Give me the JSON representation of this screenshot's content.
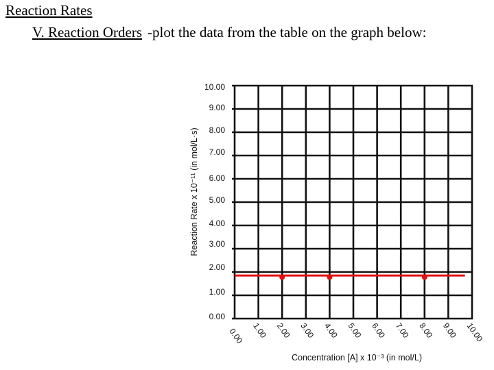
{
  "header": {
    "title": "Reaction Rates",
    "section": "V.  Reaction Orders",
    "instruction": "-plot the data from the table on the graph below:"
  },
  "chart_data": {
    "type": "scatter",
    "title": "",
    "xlabel": "Concentration [A] x 10⁻³ (in mol/L)",
    "ylabel": "Reaction Rate x 10⁻¹¹ (in mol/L·s)",
    "xlim": [
      0,
      10
    ],
    "ylim": [
      0,
      10
    ],
    "grid": true,
    "x_ticks": [
      "0.00",
      "1.00",
      "2.00",
      "3.00",
      "4.00",
      "5.00",
      "6.00",
      "7.00",
      "8.00",
      "9.00",
      "10.00"
    ],
    "y_ticks": [
      "0.00",
      "1.00",
      "2.00",
      "3.00",
      "4.00",
      "5.00",
      "6.00",
      "7.00",
      "8.00",
      "9.00",
      "10.00"
    ],
    "series": [
      {
        "name": "data points",
        "type": "scatter",
        "color": "#e01010",
        "points": [
          {
            "x": 2.0,
            "y": 1.78
          },
          {
            "x": 4.0,
            "y": 1.78
          },
          {
            "x": 8.0,
            "y": 1.78
          }
        ]
      },
      {
        "name": "best-fit line",
        "type": "line",
        "color": "#e01010",
        "points": [
          {
            "x": 0.0,
            "y": 1.85
          },
          {
            "x": 9.7,
            "y": 1.85
          }
        ]
      }
    ]
  }
}
